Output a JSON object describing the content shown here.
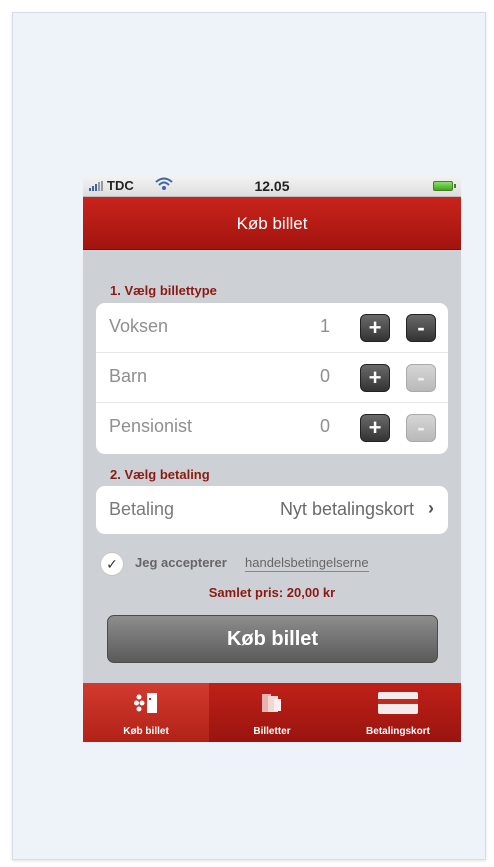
{
  "status_bar": {
    "carrier": "TDC",
    "time": "12.05"
  },
  "nav": {
    "title": "Køb billet"
  },
  "ticket_section": {
    "title": "1. Vælg billettype",
    "rows": [
      {
        "label": "Voksen",
        "count": "1",
        "plus": "+",
        "minus": "-",
        "minus_disabled": false
      },
      {
        "label": "Barn",
        "count": "0",
        "plus": "+",
        "minus": "-",
        "minus_disabled": true
      },
      {
        "label": "Pensionist",
        "count": "0",
        "plus": "+",
        "minus": "-",
        "minus_disabled": true
      }
    ]
  },
  "payment_section": {
    "title": "2. Vælg betaling",
    "label": "Betaling",
    "value": "Nyt betalingskort",
    "chevron": "›"
  },
  "accept": {
    "checked": true,
    "text": "Jeg accepterer",
    "link": "handelsbetingelserne"
  },
  "total": "Samlet pris: 20,00 kr",
  "buy_button": "Køb billet",
  "tabs": [
    {
      "label": "Køb billet",
      "icon": "buy-ticket-icon",
      "active": true
    },
    {
      "label": "Billetter",
      "icon": "tickets-icon",
      "active": false
    },
    {
      "label": "Betalingskort",
      "icon": "payment-card-icon",
      "active": false
    }
  ],
  "colors": {
    "brand_red": "#b81b14",
    "section_title": "#8b1a14",
    "background": "#cdd0d4"
  }
}
